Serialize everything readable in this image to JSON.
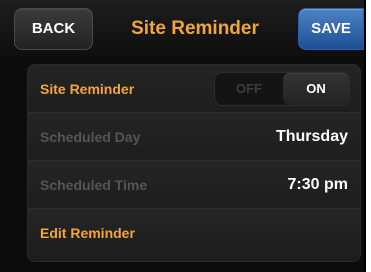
{
  "header": {
    "back_label": "BACK",
    "title": "Site Reminder",
    "save_label": "SAVE"
  },
  "settings": {
    "site_reminder": {
      "label": "Site Reminder",
      "toggle_off": "OFF",
      "toggle_on": "ON",
      "state": "ON"
    },
    "scheduled_day": {
      "label": "Scheduled Day",
      "value": "Thursday"
    },
    "scheduled_time": {
      "label": "Scheduled Time",
      "value": "7:30 pm"
    },
    "edit_reminder": {
      "label": "Edit Reminder"
    }
  },
  "colors": {
    "accent": "#f2a53a",
    "save_blue": "#2e64ab",
    "background": "#0c0c0c",
    "muted_text": "#555555"
  }
}
